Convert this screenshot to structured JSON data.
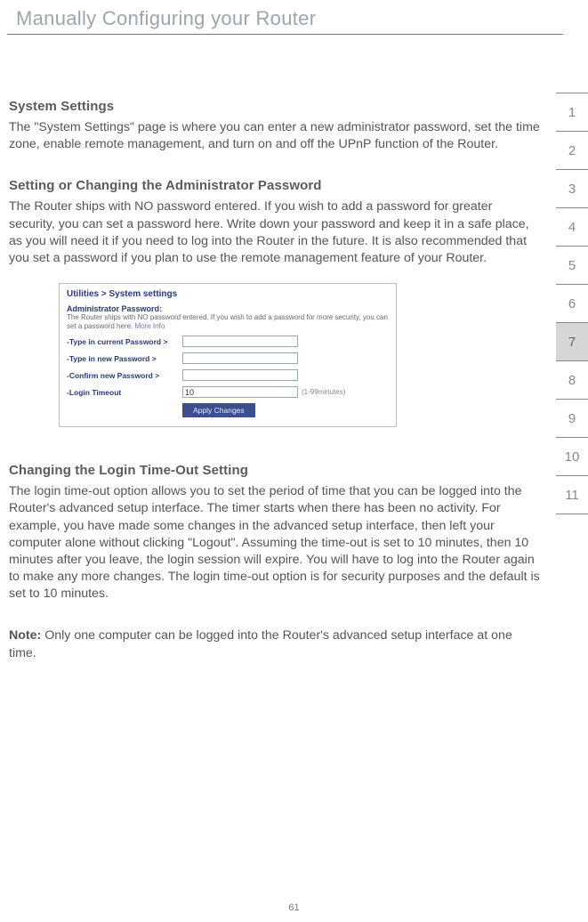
{
  "header": {
    "title": "Manually Configuring your Router"
  },
  "side_tabs": {
    "items": [
      {
        "n": "1"
      },
      {
        "n": "2"
      },
      {
        "n": "3"
      },
      {
        "n": "4"
      },
      {
        "n": "5"
      },
      {
        "n": "6"
      },
      {
        "n": "7"
      },
      {
        "n": "8"
      },
      {
        "n": "9"
      },
      {
        "n": "10"
      },
      {
        "n": "11"
      }
    ],
    "active_index": 6
  },
  "sections": {
    "system_settings": {
      "heading": "System Settings",
      "body": "The \"System Settings\" page is where you can enter a new administrator password, set the time zone, enable remote management, and turn on and off the UPnP function of the Router."
    },
    "admin_password": {
      "heading": "Setting or Changing the Administrator Password",
      "body": "The Router ships with NO password entered. If you wish to add a password for greater security, you can set a password here. Write down your password and keep it in a safe place, as you will need it if you need to log into the Router in the future. It is also recommended that you set a password if you plan to use the remote management feature of your Router."
    },
    "login_timeout": {
      "heading": "Changing the Login Time-Out Setting",
      "body": "The login time-out option allows you to set the period of time that you can be logged into the Router's advanced setup interface. The timer starts when there has been no activity. For example, you have made some changes in the advanced setup interface, then left your computer alone without clicking \"Logout\". Assuming the time-out is set to 10 minutes, then 10 minutes after you leave, the login session will expire. You will have to log into the Router again to make any more changes. The login time-out option is for security purposes and the default is set to 10 minutes."
    },
    "note": {
      "label": "Note:",
      "body": " Only one computer can be logged into the Router's advanced setup interface at one time."
    }
  },
  "inset": {
    "breadcrumb": "Utilities > System settings",
    "subhead": "Administrator Password:",
    "desc": "The Router ships with NO password entered. If you wish to add a password for more security, you can set a password here. ",
    "more": "More Info",
    "rows": {
      "current": "-Type in current Password >",
      "new": "-Type in new Password >",
      "confirm": "-Confirm new Password >",
      "timeout": "-Login Timeout"
    },
    "timeout_value": "10",
    "timeout_hint": "(1-99minutes)",
    "button": "Apply Changes"
  },
  "page_number": "61"
}
